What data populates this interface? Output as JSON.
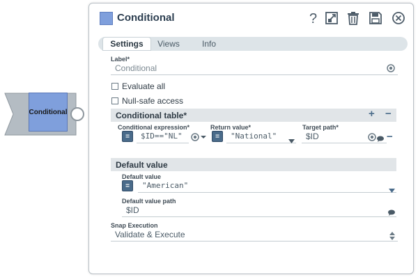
{
  "node": {
    "label": "Conditional"
  },
  "dialog": {
    "title": "Conditional",
    "icons": [
      "help-icon",
      "export-icon",
      "delete-icon",
      "save-icon",
      "close-icon"
    ],
    "tabs": [
      "Settings",
      "Views",
      "Info"
    ],
    "active_tab": "Settings",
    "label_field": {
      "label": "Label*",
      "value": "Conditional"
    },
    "evaluate_all": {
      "label": "Evaluate all",
      "checked": false
    },
    "null_safe": {
      "label": "Null-safe access",
      "checked": false
    },
    "conditional_table": {
      "title": "Conditional table*",
      "add": "+",
      "remove": "−",
      "columns": [
        "Conditional expression*",
        "Return value*",
        "Target path*"
      ],
      "rows": [
        {
          "expression": "$ID==\"NL\"",
          "return_value": "\"National\"",
          "target_path": "$ID"
        }
      ]
    },
    "default_value_section": {
      "title": "Default value",
      "default_value": {
        "label": "Default value",
        "value": "\"American\""
      },
      "default_value_path": {
        "label": "Default value path",
        "value": "$ID"
      }
    },
    "snap_execution": {
      "label": "Snap Execution",
      "value": "Validate & Execute"
    },
    "eq_symbol": "="
  },
  "colors": {
    "accent": "#7f9fdc",
    "button": "#4a6b8a",
    "section": "#e1e5e8"
  }
}
